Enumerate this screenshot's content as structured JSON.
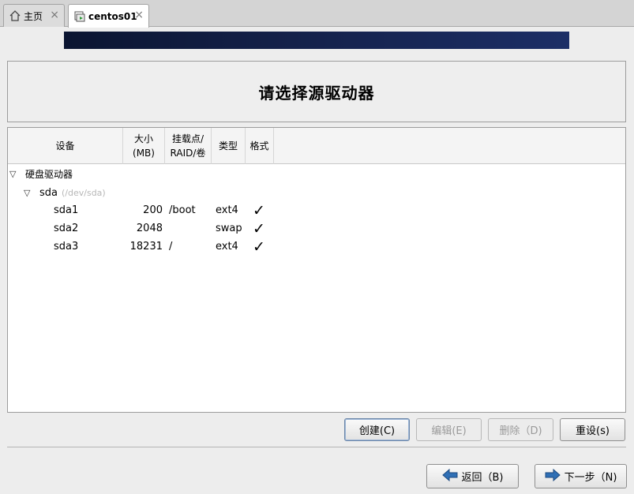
{
  "tabs": [
    {
      "label": "主页",
      "icon": "home-icon",
      "close": "×"
    },
    {
      "label": "centos01",
      "icon": "vm-icon",
      "close": "×"
    }
  ],
  "title": "请选择源驱动器",
  "columns": {
    "device": "设备",
    "size_line1": "大小",
    "size_line2": "(MB)",
    "mount_line1": "挂载点/",
    "mount_line2": "RAID/卷",
    "type": "类型",
    "format": "格式"
  },
  "tree": {
    "group_label": "硬盘驱动器",
    "disk": {
      "name": "sda",
      "path": "(/dev/sda)"
    },
    "partitions": [
      {
        "name": "sda1",
        "size": "200",
        "mount": "/boot",
        "type": "ext4",
        "format": "✓"
      },
      {
        "name": "sda2",
        "size": "2048",
        "mount": "",
        "type": "swap",
        "format": "✓"
      },
      {
        "name": "sda3",
        "size": "18231",
        "mount": "/",
        "type": "ext4",
        "format": "✓"
      }
    ]
  },
  "actions": {
    "create": "创建(C)",
    "edit": "编辑(E)",
    "delete": "删除（D)",
    "reset": "重设(s)"
  },
  "nav": {
    "back": "返回（B)",
    "next": "下一步（N)"
  },
  "colors": {
    "banner": "#0f1c45",
    "accent": "#2f6fb5"
  }
}
